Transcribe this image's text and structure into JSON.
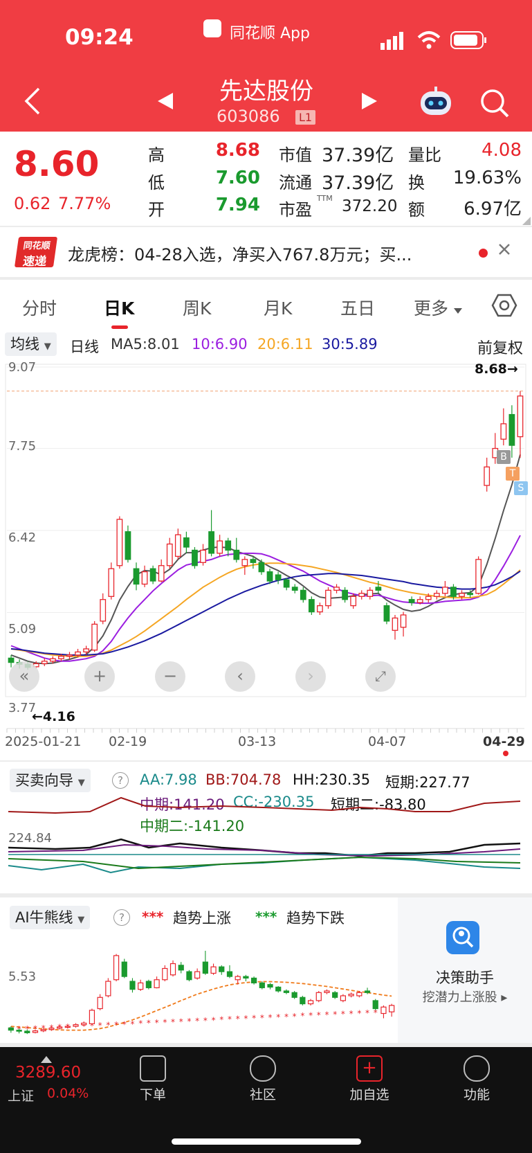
{
  "status_bar": {
    "time": "09:24",
    "app_badge": "同花顺 App"
  },
  "header": {
    "name": "先达股份",
    "code": "603086",
    "level": "L1"
  },
  "quote": {
    "price": "8.60",
    "change": "0.62",
    "change_pct": "7.77%",
    "rows": [
      {
        "l1": "高",
        "v1": "8.68",
        "l2": "市值",
        "v2": "37.39亿",
        "l3": "量比",
        "v3": "4.08"
      },
      {
        "l1": "低",
        "v1": "7.60",
        "l2": "流通",
        "v2": "37.39亿",
        "l3": "换",
        "v3": "19.63%"
      },
      {
        "l1": "开",
        "v1": "7.94",
        "l2": "市盈",
        "v2": "372.20",
        "l3": "额",
        "v3": "6.97亿"
      }
    ],
    "pe_tag": "TTM",
    "colors": {
      "up": "#e8242b",
      "down": "#1a9a2e"
    }
  },
  "news": {
    "logo_top": "同花顺",
    "logo_bottom": "速递",
    "text": "龙虎榜：04-28入选，净买入767.8万元；买..."
  },
  "tabs": [
    "分时",
    "日K",
    "周K",
    "月K",
    "五日",
    "更多"
  ],
  "chart_header": {
    "ma_selector": "均线",
    "period": "日线",
    "ma5": "MA5:8.01",
    "ma10": "10:6.90",
    "ma20": "20:6.11",
    "ma30": "30:5.89",
    "adjust": "前复权"
  },
  "chart_data": {
    "type": "candlestick",
    "y_ticks": [
      "9.07",
      "7.75",
      "6.42",
      "5.09",
      "3.77"
    ],
    "ylim": [
      3.77,
      9.07
    ],
    "x_ticks": [
      "2025-01-21",
      "02-19",
      "03-13",
      "04-07",
      "04-29"
    ],
    "high_marker": "8.68→",
    "low_marker": "←4.16",
    "candles": [
      {
        "o": 4.35,
        "c": 4.28,
        "h": 4.4,
        "l": 4.2
      },
      {
        "o": 4.28,
        "c": 4.25,
        "h": 4.33,
        "l": 4.18
      },
      {
        "o": 4.25,
        "c": 4.2,
        "h": 4.3,
        "l": 4.16
      },
      {
        "o": 4.21,
        "c": 4.26,
        "h": 4.3,
        "l": 4.18
      },
      {
        "o": 4.26,
        "c": 4.3,
        "h": 4.35,
        "l": 4.22
      },
      {
        "o": 4.3,
        "c": 4.34,
        "h": 4.38,
        "l": 4.26
      },
      {
        "o": 4.34,
        "c": 4.38,
        "h": 4.42,
        "l": 4.3
      },
      {
        "o": 4.38,
        "c": 4.4,
        "h": 4.45,
        "l": 4.33
      },
      {
        "o": 4.4,
        "c": 4.45,
        "h": 4.5,
        "l": 4.36
      },
      {
        "o": 4.45,
        "c": 4.5,
        "h": 4.55,
        "l": 4.4
      },
      {
        "o": 4.48,
        "c": 4.9,
        "h": 4.95,
        "l": 4.45
      },
      {
        "o": 4.95,
        "c": 5.3,
        "h": 5.4,
        "l": 4.9
      },
      {
        "o": 5.35,
        "c": 5.8,
        "h": 5.9,
        "l": 5.3
      },
      {
        "o": 5.85,
        "c": 6.6,
        "h": 6.65,
        "l": 5.8
      },
      {
        "o": 6.4,
        "c": 5.95,
        "h": 6.5,
        "l": 5.9
      },
      {
        "o": 5.8,
        "c": 5.55,
        "h": 5.9,
        "l": 5.45
      },
      {
        "o": 5.55,
        "c": 5.75,
        "h": 5.85,
        "l": 5.5
      },
      {
        "o": 5.8,
        "c": 5.6,
        "h": 5.85,
        "l": 5.55
      },
      {
        "o": 5.6,
        "c": 5.85,
        "h": 5.95,
        "l": 5.58
      },
      {
        "o": 5.85,
        "c": 6.2,
        "h": 6.3,
        "l": 5.8
      },
      {
        "o": 6.0,
        "c": 6.35,
        "h": 6.45,
        "l": 5.95
      },
      {
        "o": 6.3,
        "c": 6.15,
        "h": 6.4,
        "l": 6.05
      },
      {
        "o": 6.1,
        "c": 5.85,
        "h": 6.15,
        "l": 5.8
      },
      {
        "o": 5.9,
        "c": 6.1,
        "h": 6.2,
        "l": 5.85
      },
      {
        "o": 6.4,
        "c": 6.05,
        "h": 6.75,
        "l": 6.0
      },
      {
        "o": 6.05,
        "c": 6.25,
        "h": 6.35,
        "l": 6.0
      },
      {
        "o": 6.25,
        "c": 6.1,
        "h": 6.3,
        "l": 6.0
      },
      {
        "o": 6.1,
        "c": 5.95,
        "h": 6.3,
        "l": 5.9
      },
      {
        "o": 5.85,
        "c": 5.95,
        "h": 6.0,
        "l": 5.7
      },
      {
        "o": 5.95,
        "c": 5.9,
        "h": 6.0,
        "l": 5.8
      },
      {
        "o": 5.9,
        "c": 5.75,
        "h": 5.95,
        "l": 5.7
      },
      {
        "o": 5.75,
        "c": 5.6,
        "h": 5.8,
        "l": 5.55
      },
      {
        "o": 5.7,
        "c": 5.62,
        "h": 5.75,
        "l": 5.55
      },
      {
        "o": 5.62,
        "c": 5.5,
        "h": 5.65,
        "l": 5.45
      },
      {
        "o": 5.5,
        "c": 5.45,
        "h": 5.55,
        "l": 5.4
      },
      {
        "o": 5.45,
        "c": 5.3,
        "h": 5.5,
        "l": 5.25
      },
      {
        "o": 5.3,
        "c": 5.1,
        "h": 5.35,
        "l": 5.05
      },
      {
        "o": 5.1,
        "c": 5.2,
        "h": 5.25,
        "l": 5.05
      },
      {
        "o": 5.2,
        "c": 5.45,
        "h": 5.5,
        "l": 5.15
      },
      {
        "o": 5.45,
        "c": 5.5,
        "h": 5.55,
        "l": 5.4
      },
      {
        "o": 5.45,
        "c": 5.3,
        "h": 5.5,
        "l": 5.25
      },
      {
        "o": 5.2,
        "c": 5.35,
        "h": 5.4,
        "l": 5.15
      },
      {
        "o": 5.35,
        "c": 5.4,
        "h": 5.45,
        "l": 5.3
      },
      {
        "o": 5.35,
        "c": 5.45,
        "h": 5.5,
        "l": 5.3
      },
      {
        "o": 5.5,
        "c": 5.45,
        "h": 5.6,
        "l": 5.4
      },
      {
        "o": 5.2,
        "c": 4.95,
        "h": 5.25,
        "l": 4.9
      },
      {
        "o": 4.8,
        "c": 5.0,
        "h": 5.05,
        "l": 4.65
      },
      {
        "o": 4.85,
        "c": 5.05,
        "h": 5.1,
        "l": 4.7
      },
      {
        "o": 5.3,
        "c": 5.25,
        "h": 5.35,
        "l": 5.2
      },
      {
        "o": 5.25,
        "c": 5.3,
        "h": 5.35,
        "l": 5.22
      },
      {
        "o": 5.3,
        "c": 5.35,
        "h": 5.4,
        "l": 5.25
      },
      {
        "o": 5.35,
        "c": 5.4,
        "h": 5.45,
        "l": 5.3
      },
      {
        "o": 5.4,
        "c": 5.5,
        "h": 5.6,
        "l": 5.35
      },
      {
        "o": 5.5,
        "c": 5.35,
        "h": 5.55,
        "l": 5.3
      },
      {
        "o": 5.35,
        "c": 5.4,
        "h": 5.45,
        "l": 5.3
      },
      {
        "o": 5.4,
        "c": 5.38,
        "h": 5.45,
        "l": 5.33
      },
      {
        "o": 5.4,
        "c": 5.95,
        "h": 6.0,
        "l": 5.38
      },
      {
        "o": 7.15,
        "c": 7.45,
        "h": 7.6,
        "l": 7.05
      },
      {
        "o": 7.6,
        "c": 7.75,
        "h": 8.0,
        "l": 7.5
      },
      {
        "o": 7.9,
        "c": 8.15,
        "h": 8.4,
        "l": 7.8
      },
      {
        "o": 8.3,
        "c": 7.8,
        "h": 8.45,
        "l": 7.6
      },
      {
        "o": 7.94,
        "c": 8.6,
        "h": 8.68,
        "l": 7.6
      }
    ],
    "series": [
      {
        "name": "MA5",
        "color": "#555555",
        "values": [
          4.4,
          4.35,
          4.3,
          4.27,
          4.26,
          4.27,
          4.3,
          4.33,
          4.37,
          4.41,
          4.53,
          4.71,
          4.97,
          5.29,
          5.51,
          5.7,
          5.77,
          5.76,
          5.7,
          5.79,
          5.95,
          6.06,
          6.06,
          6.1,
          6.14,
          6.15,
          6.14,
          6.08,
          6.04,
          6.0,
          5.91,
          5.83,
          5.77,
          5.69,
          5.62,
          5.52,
          5.41,
          5.34,
          5.32,
          5.33,
          5.34,
          5.36,
          5.38,
          5.39,
          5.4,
          5.29,
          5.21,
          5.14,
          5.11,
          5.13,
          5.19,
          5.27,
          5.33,
          5.38,
          5.4,
          5.41,
          5.52,
          5.87,
          6.29,
          6.74,
          7.16,
          7.65
        ]
      },
      {
        "name": "MA10",
        "color": "#9b1ee0",
        "values": [
          4.55,
          4.5,
          4.45,
          4.4,
          4.35,
          4.32,
          4.3,
          4.3,
          4.32,
          4.34,
          4.38,
          4.47,
          4.62,
          4.82,
          5.0,
          5.16,
          5.3,
          5.44,
          5.56,
          5.67,
          5.78,
          5.86,
          5.89,
          5.92,
          5.95,
          6.0,
          6.03,
          6.04,
          6.05,
          6.05,
          6.04,
          6.0,
          5.94,
          5.88,
          5.82,
          5.76,
          5.68,
          5.6,
          5.54,
          5.48,
          5.42,
          5.39,
          5.36,
          5.36,
          5.37,
          5.33,
          5.29,
          5.26,
          5.25,
          5.24,
          5.24,
          5.25,
          5.27,
          5.28,
          5.29,
          5.3,
          5.34,
          5.44,
          5.62,
          5.84,
          6.08,
          6.34
        ]
      },
      {
        "name": "MA20",
        "color": "#f5a623",
        "values": [
          4.5,
          4.48,
          4.46,
          4.44,
          4.42,
          4.4,
          4.39,
          4.38,
          4.38,
          4.38,
          4.4,
          4.43,
          4.48,
          4.55,
          4.62,
          4.7,
          4.79,
          4.89,
          4.99,
          5.09,
          5.19,
          5.3,
          5.4,
          5.5,
          5.58,
          5.66,
          5.73,
          5.79,
          5.83,
          5.86,
          5.88,
          5.89,
          5.89,
          5.88,
          5.87,
          5.85,
          5.83,
          5.8,
          5.77,
          5.74,
          5.7,
          5.66,
          5.62,
          5.58,
          5.55,
          5.51,
          5.47,
          5.44,
          5.41,
          5.39,
          5.37,
          5.35,
          5.34,
          5.33,
          5.33,
          5.33,
          5.35,
          5.38,
          5.45,
          5.55,
          5.66,
          5.78
        ]
      },
      {
        "name": "MA30",
        "color": "#1a1aa0",
        "values": [
          4.5,
          4.49,
          4.47,
          4.45,
          4.43,
          4.42,
          4.41,
          4.4,
          4.4,
          4.4,
          4.41,
          4.42,
          4.45,
          4.49,
          4.53,
          4.58,
          4.63,
          4.69,
          4.75,
          4.82,
          4.89,
          4.96,
          5.03,
          5.1,
          5.17,
          5.24,
          5.31,
          5.37,
          5.43,
          5.48,
          5.53,
          5.57,
          5.61,
          5.64,
          5.67,
          5.69,
          5.7,
          5.71,
          5.72,
          5.72,
          5.71,
          5.7,
          5.69,
          5.67,
          5.65,
          5.63,
          5.61,
          5.59,
          5.56,
          5.54,
          5.52,
          5.5,
          5.49,
          5.48,
          5.47,
          5.47,
          5.48,
          5.5,
          5.54,
          5.6,
          5.67,
          5.76
        ]
      }
    ],
    "signals": [
      "B",
      "T",
      "S"
    ]
  },
  "indicator1": {
    "selector": "买卖向导",
    "values": [
      "AA:7.98",
      "BB:704.78",
      "HH:230.35",
      "短期:227.77",
      "中期:141.20",
      "CC:-230.35",
      "短期二:-83.80",
      "中期二:-141.20"
    ],
    "colors": [
      "#1a8a8a",
      "#a01818",
      "#111111",
      "#111111",
      "#6a1a7a",
      "#1a8a8a",
      "#111111",
      "#1a7a1a"
    ],
    "level": "224.84"
  },
  "indicator2": {
    "selector": "AI牛熊线",
    "legend_up_marks": "***",
    "legend_up": "趋势上涨",
    "legend_down_marks": "***",
    "legend_down": "趋势下跌",
    "level": "5.53",
    "promo_title": "决策助手",
    "promo_sub": "挖潜力上涨股 ▸"
  },
  "bottom_bar": {
    "index_value": "3289.60",
    "index_name": "上证",
    "index_change": "0.04%",
    "items": [
      "下单",
      "社区",
      "加自选",
      "功能"
    ]
  }
}
